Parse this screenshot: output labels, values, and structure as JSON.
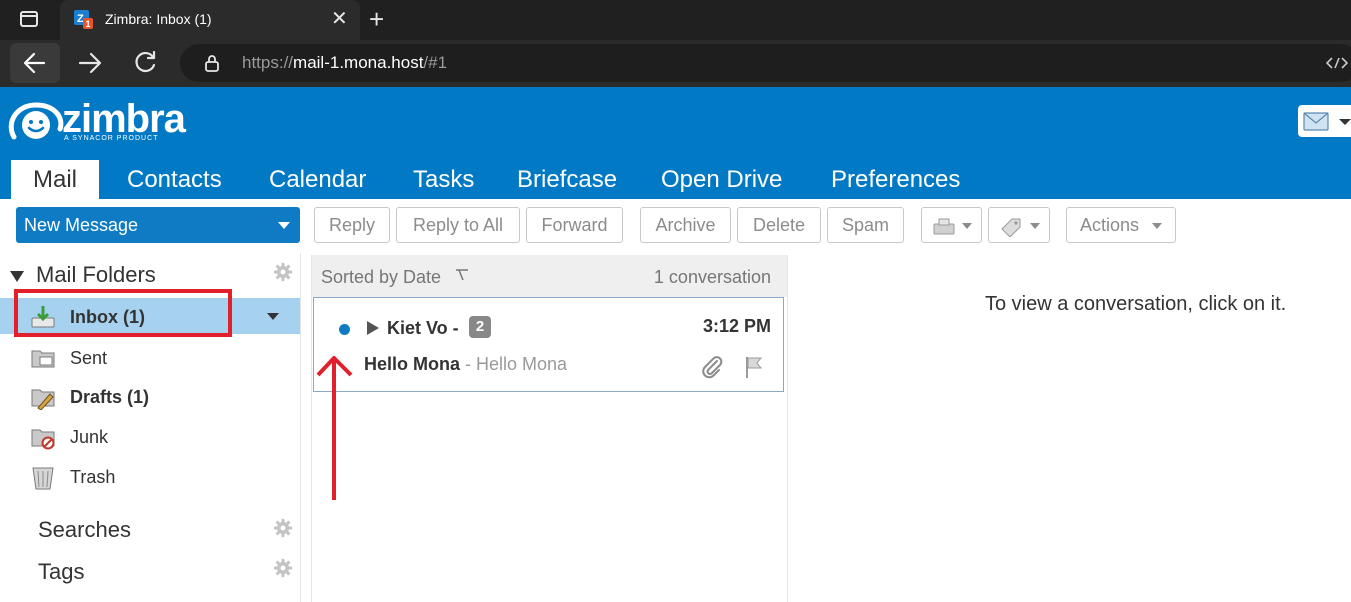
{
  "browser": {
    "tab_title": "Zimbra: Inbox (1)",
    "favicon_badge": "1",
    "close_glyph": "✕",
    "newtab_glyph": "+",
    "url_scheme": "https://",
    "url_host": "mail-1.mona.host",
    "url_path": "/#1"
  },
  "header": {
    "logo_word": "zimbra",
    "logo_sub": "A SYNACOR PRODUCT",
    "brand_color": "#0279c4",
    "apps": [
      "Mail",
      "Contacts",
      "Calendar",
      "Tasks",
      "Briefcase",
      "Open Drive",
      "Preferences"
    ]
  },
  "toolbar": {
    "new_message": "New Message",
    "reply": "Reply",
    "reply_all": "Reply to All",
    "forward": "Forward",
    "archive": "Archive",
    "delete": "Delete",
    "spam": "Spam",
    "actions": "Actions"
  },
  "sidebar": {
    "mail_folders_title": "Mail Folders",
    "folders": [
      {
        "label": "Inbox (1)",
        "icon": "inbox-icon",
        "bold": true,
        "selected": true
      },
      {
        "label": "Sent",
        "icon": "sent-folder-icon",
        "bold": false
      },
      {
        "label": "Drafts (1)",
        "icon": "drafts-folder-icon",
        "bold": true
      },
      {
        "label": "Junk",
        "icon": "junk-folder-icon",
        "bold": false
      },
      {
        "label": "Trash",
        "icon": "trash-icon",
        "bold": false
      }
    ],
    "searches_title": "Searches",
    "tags_title": "Tags"
  },
  "message_list": {
    "sort_label": "Sorted by Date",
    "count_label": "1 conversation",
    "messages": [
      {
        "sender": "Kiet Vo -",
        "count": "2",
        "time": "3:12 PM",
        "subject": "Hello Mona",
        "fragment": " - Hello Mona",
        "unread": true
      }
    ]
  },
  "reading_pane": {
    "hint": "To view a conversation, click on it."
  },
  "annotation_color": "#e2202b"
}
